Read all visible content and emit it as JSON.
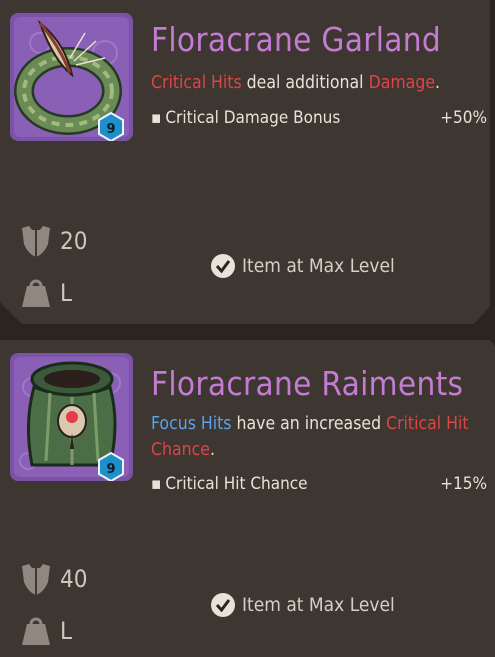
{
  "items": [
    {
      "name": "Floracrane Garland",
      "level": "9",
      "description": [
        {
          "text": "Critical Hits",
          "color": "red"
        },
        {
          "text": " deal additional ",
          "color": "plain"
        },
        {
          "text": "Damage",
          "color": "red"
        },
        {
          "text": ".",
          "color": "plain"
        }
      ],
      "stat_label": "Critical Damage Bonus",
      "stat_value": "+50%",
      "armor_value": "20",
      "weight_class": "L",
      "status": "Item at Max Level"
    },
    {
      "name": "Floracrane Raiments",
      "level": "9",
      "description": [
        {
          "text": "Focus Hits",
          "color": "blue"
        },
        {
          "text": " have an increased ",
          "color": "plain"
        },
        {
          "text": "Critical Hit Chance",
          "color": "red"
        },
        {
          "text": ".",
          "color": "plain"
        }
      ],
      "stat_label": "Critical Hit Chance",
      "stat_value": "+15%",
      "armor_value": "40",
      "weight_class": "L",
      "status": "Item at Max Level"
    }
  ],
  "colors": {
    "item_name": "#c47cd3",
    "keyword_red": "#e04545",
    "keyword_blue": "#5aa1ee",
    "card_bg": "#3d3631",
    "portrait_bg": "#7a52a6",
    "level_badge": "#1f8fc9"
  },
  "icons": {
    "armor": "shield-icon",
    "weight": "weight-icon",
    "status": "checkmark-icon"
  }
}
